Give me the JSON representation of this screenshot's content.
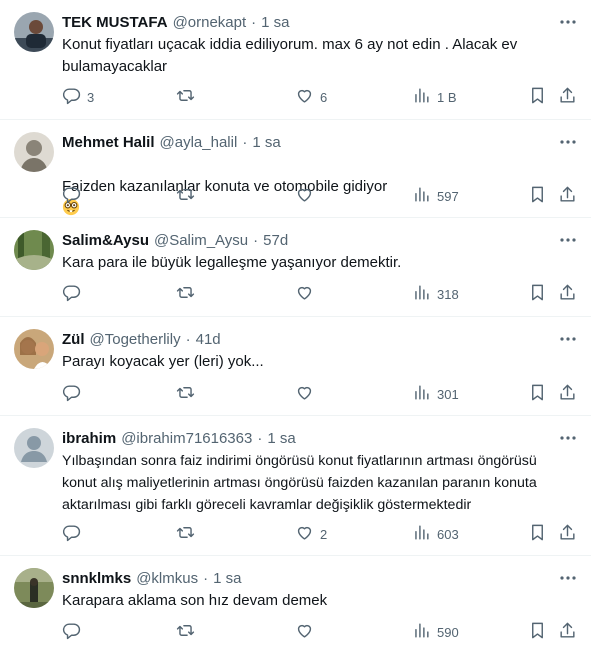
{
  "tweets": [
    {
      "name": "TEK MUSTAFA",
      "handle": "@ornekapt",
      "time": "1 sa",
      "text": "Konut fiyatları uçacak iddia ediliyorum. max 6 ay not edin . Alacak ev\nbulamayacaklar",
      "replies": "3",
      "retweets": "",
      "likes": "6",
      "views": "1 B"
    },
    {
      "name": "Mehmet Halil",
      "handle": "@ayla_halil",
      "time": "1 sa",
      "text": "Faizden kazanılanlar konuta ve otomobile gidiyor",
      "emoji": "nerd-face-emoji",
      "replies": "",
      "retweets": "",
      "likes": "",
      "views": "597"
    },
    {
      "name": "Salim&Aysu",
      "handle": "@Salim_Aysu",
      "time": "57d",
      "text": "Kara para ile büyük legalleşme yaşanıyor demektir.",
      "replies": "",
      "retweets": "",
      "likes": "",
      "views": "318"
    },
    {
      "name": "Zül",
      "handle": "@Togetherlily",
      "time": "41d",
      "text": "Parayı koyacak yer (leri) yok...",
      "replies": "",
      "retweets": "",
      "likes": "",
      "views": "301"
    },
    {
      "name": "ibrahim",
      "handle": "@ibrahim71616363",
      "time": "1 sa",
      "text": "Yılbaşından sonra faiz indirimi öngörüsü konut fiyatlarının artması öngörüsü\nkonut alış maliyetlerinin artması öngörüsü faizden kazanılan paranın konuta\naktarılması gibi farklı göreceli kavramlar değişiklik göstermektedir",
      "replies": "",
      "retweets": "",
      "likes": "2",
      "views": "603"
    },
    {
      "name": "snnklmks",
      "handle": "@klmkus",
      "time": "1 sa",
      "text": "Karapara aklama son hız devam demek",
      "replies": "",
      "retweets": "",
      "likes": "",
      "views": "590"
    }
  ],
  "icons": {
    "more": "more-dots-icon",
    "reply": "reply-icon",
    "retweet": "retweet-icon",
    "like": "heart-icon",
    "views": "views-chart-icon",
    "bookmark": "bookmark-icon",
    "share": "share-icon"
  },
  "colors": {
    "text": "#0f1419",
    "secondary": "#536471",
    "divider": "#eff3f4"
  }
}
